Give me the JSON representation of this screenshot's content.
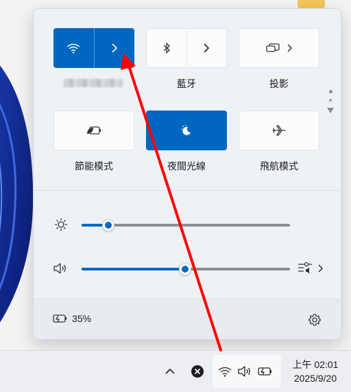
{
  "tiles": {
    "wifi": {
      "icon": "wifi-icon",
      "expand_icon": "chevron-right-icon",
      "state": "on"
    },
    "bluetooth": {
      "label": "藍牙",
      "icon": "bluetooth-icon",
      "expand_icon": "chevron-right-icon",
      "state": "off"
    },
    "cast": {
      "label": "投影",
      "icon": "cast-icon",
      "expand_icon": "chevron-right-icon",
      "state": "off"
    },
    "battery_saver": {
      "label": "節能模式",
      "icon": "battery-saver-icon",
      "state": "off"
    },
    "night_light": {
      "label": "夜間光線",
      "icon": "night-light-icon",
      "state": "on"
    },
    "airplane_mode": {
      "label": "飛航模式",
      "icon": "airplane-icon",
      "state": "off"
    }
  },
  "sliders": {
    "brightness": {
      "icon": "brightness-icon",
      "value": 0.13
    },
    "volume": {
      "icon": "volume-icon",
      "value": 0.5,
      "output_icon": "audio-output-select-icon"
    }
  },
  "footer": {
    "battery_text": "35%",
    "battery_icon": "battery-charging-icon",
    "settings_icon": "gear-icon"
  },
  "taskbar": {
    "tray_icons": [
      "chevron-up-icon",
      "close-circle-icon",
      "wifi-icon",
      "volume-icon",
      "battery-charging-icon"
    ],
    "time": "上午 02:01",
    "date": "2025/9/20"
  },
  "colors": {
    "accent": "#0067c0",
    "annotation_arrow": "#ff0000"
  }
}
